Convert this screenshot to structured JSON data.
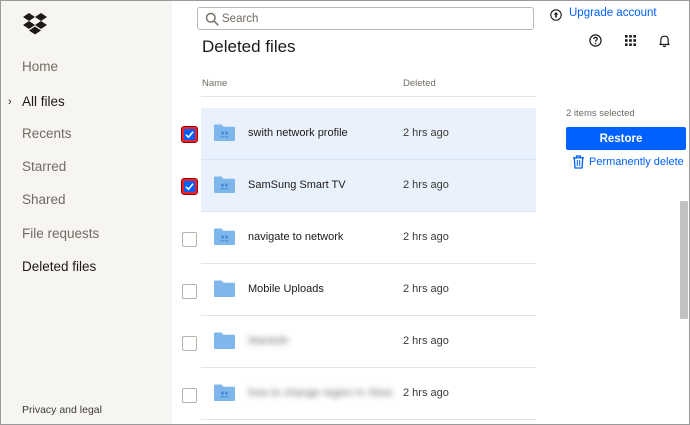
{
  "sidebar": {
    "items": [
      {
        "label": "Home"
      },
      {
        "label": "All files"
      },
      {
        "label": "Recents"
      },
      {
        "label": "Starred"
      },
      {
        "label": "Shared"
      },
      {
        "label": "File requests"
      },
      {
        "label": "Deleted files"
      }
    ],
    "expanded_marker": "›",
    "footer": "Privacy and legal"
  },
  "search": {
    "placeholder": "Search",
    "value": ""
  },
  "header": {
    "title": "Deleted files",
    "upgrade_label": "Upgrade account"
  },
  "table": {
    "columns": [
      "Name",
      "Deleted"
    ],
    "rows": [
      {
        "name": "swith network profile",
        "deleted": "2 hrs ago",
        "checked": true,
        "shared_folder": true
      },
      {
        "name": "SamSung Smart TV",
        "deleted": "2 hrs ago",
        "checked": true,
        "shared_folder": true
      },
      {
        "name": "navigate to network",
        "deleted": "2 hrs ago",
        "checked": false,
        "shared_folder": true
      },
      {
        "name": "Mobile Uploads",
        "deleted": "2 hrs ago",
        "checked": false,
        "shared_folder": false
      },
      {
        "name": "Wantoth",
        "deleted": "2 hrs ago",
        "checked": false,
        "shared_folder": false
      },
      {
        "name": "how to change region in Xbox",
        "deleted": "2 hrs ago",
        "checked": false,
        "shared_folder": true
      }
    ]
  },
  "panel": {
    "selection_text": "2 items selected",
    "restore_label": "Restore",
    "delete_label": "Permanently delete"
  },
  "colors": {
    "accent": "#0061fe",
    "selected_row": "#e9f1fc",
    "checkbox_highlight": "#e8222b",
    "folder": "#7fb7ec"
  },
  "icons": [
    "dropbox-logo-icon",
    "search-icon",
    "arrow-up-circle-icon",
    "help-icon",
    "apps-grid-icon",
    "bell-icon",
    "folder-icon",
    "shared-folder-icon",
    "trash-icon",
    "check-icon"
  ]
}
